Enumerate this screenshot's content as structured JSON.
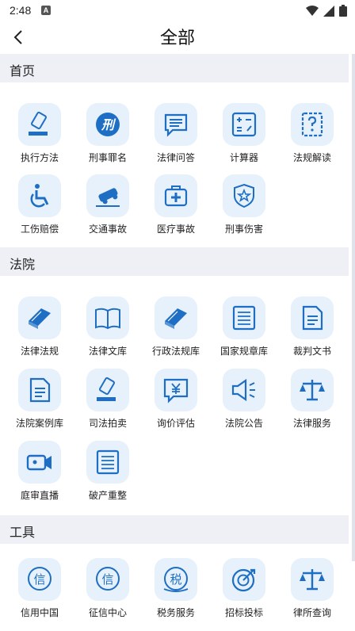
{
  "status": {
    "time": "2:48",
    "notif_glyph": "A"
  },
  "header": {
    "title": "全部"
  },
  "sections": [
    {
      "title": "首页",
      "items": [
        {
          "label": "执行方法",
          "icon": "gavel-icon"
        },
        {
          "label": "刑事罪名",
          "icon": "criminal-badge-icon"
        },
        {
          "label": "法律问答",
          "icon": "chat-bubble-icon"
        },
        {
          "label": "计算器",
          "icon": "calculator-icon"
        },
        {
          "label": "法规解读",
          "icon": "question-doc-icon"
        },
        {
          "label": "工伤赔偿",
          "icon": "wheelchair-icon"
        },
        {
          "label": "交通事故",
          "icon": "car-accident-icon"
        },
        {
          "label": "医疗事故",
          "icon": "medical-kit-icon"
        },
        {
          "label": "刑事伤害",
          "icon": "police-shield-icon"
        }
      ]
    },
    {
      "title": "法院",
      "items": [
        {
          "label": "法律法规",
          "icon": "law-book-icon"
        },
        {
          "label": "法律文库",
          "icon": "open-book-icon"
        },
        {
          "label": "行政法规库",
          "icon": "law-book-icon"
        },
        {
          "label": "国家规章库",
          "icon": "register-icon"
        },
        {
          "label": "裁判文书",
          "icon": "document-icon"
        },
        {
          "label": "法院案例库",
          "icon": "document-icon"
        },
        {
          "label": "司法拍卖",
          "icon": "gavel-icon"
        },
        {
          "label": "询价评估",
          "icon": "yuan-chat-icon"
        },
        {
          "label": "法院公告",
          "icon": "megaphone-icon"
        },
        {
          "label": "法律服务",
          "icon": "scales-icon"
        },
        {
          "label": "庭审直播",
          "icon": "video-camera-icon"
        },
        {
          "label": "破产重整",
          "icon": "register-icon"
        }
      ]
    },
    {
      "title": "工具",
      "items": [
        {
          "label": "信用中国",
          "icon": "credit-xin-icon",
          "glyph": "信"
        },
        {
          "label": "征信中心",
          "icon": "credit-xin-icon",
          "glyph": "信"
        },
        {
          "label": "税务服务",
          "icon": "tax-service-icon",
          "glyph": "税"
        },
        {
          "label": "招标投标",
          "icon": "target-icon"
        },
        {
          "label": "律所查询",
          "icon": "scales-icon"
        }
      ]
    }
  ],
  "colors": {
    "accent": "#1e6fc4",
    "icon_bg": "#e6f1fb",
    "section_bg": "#eef0f6"
  }
}
